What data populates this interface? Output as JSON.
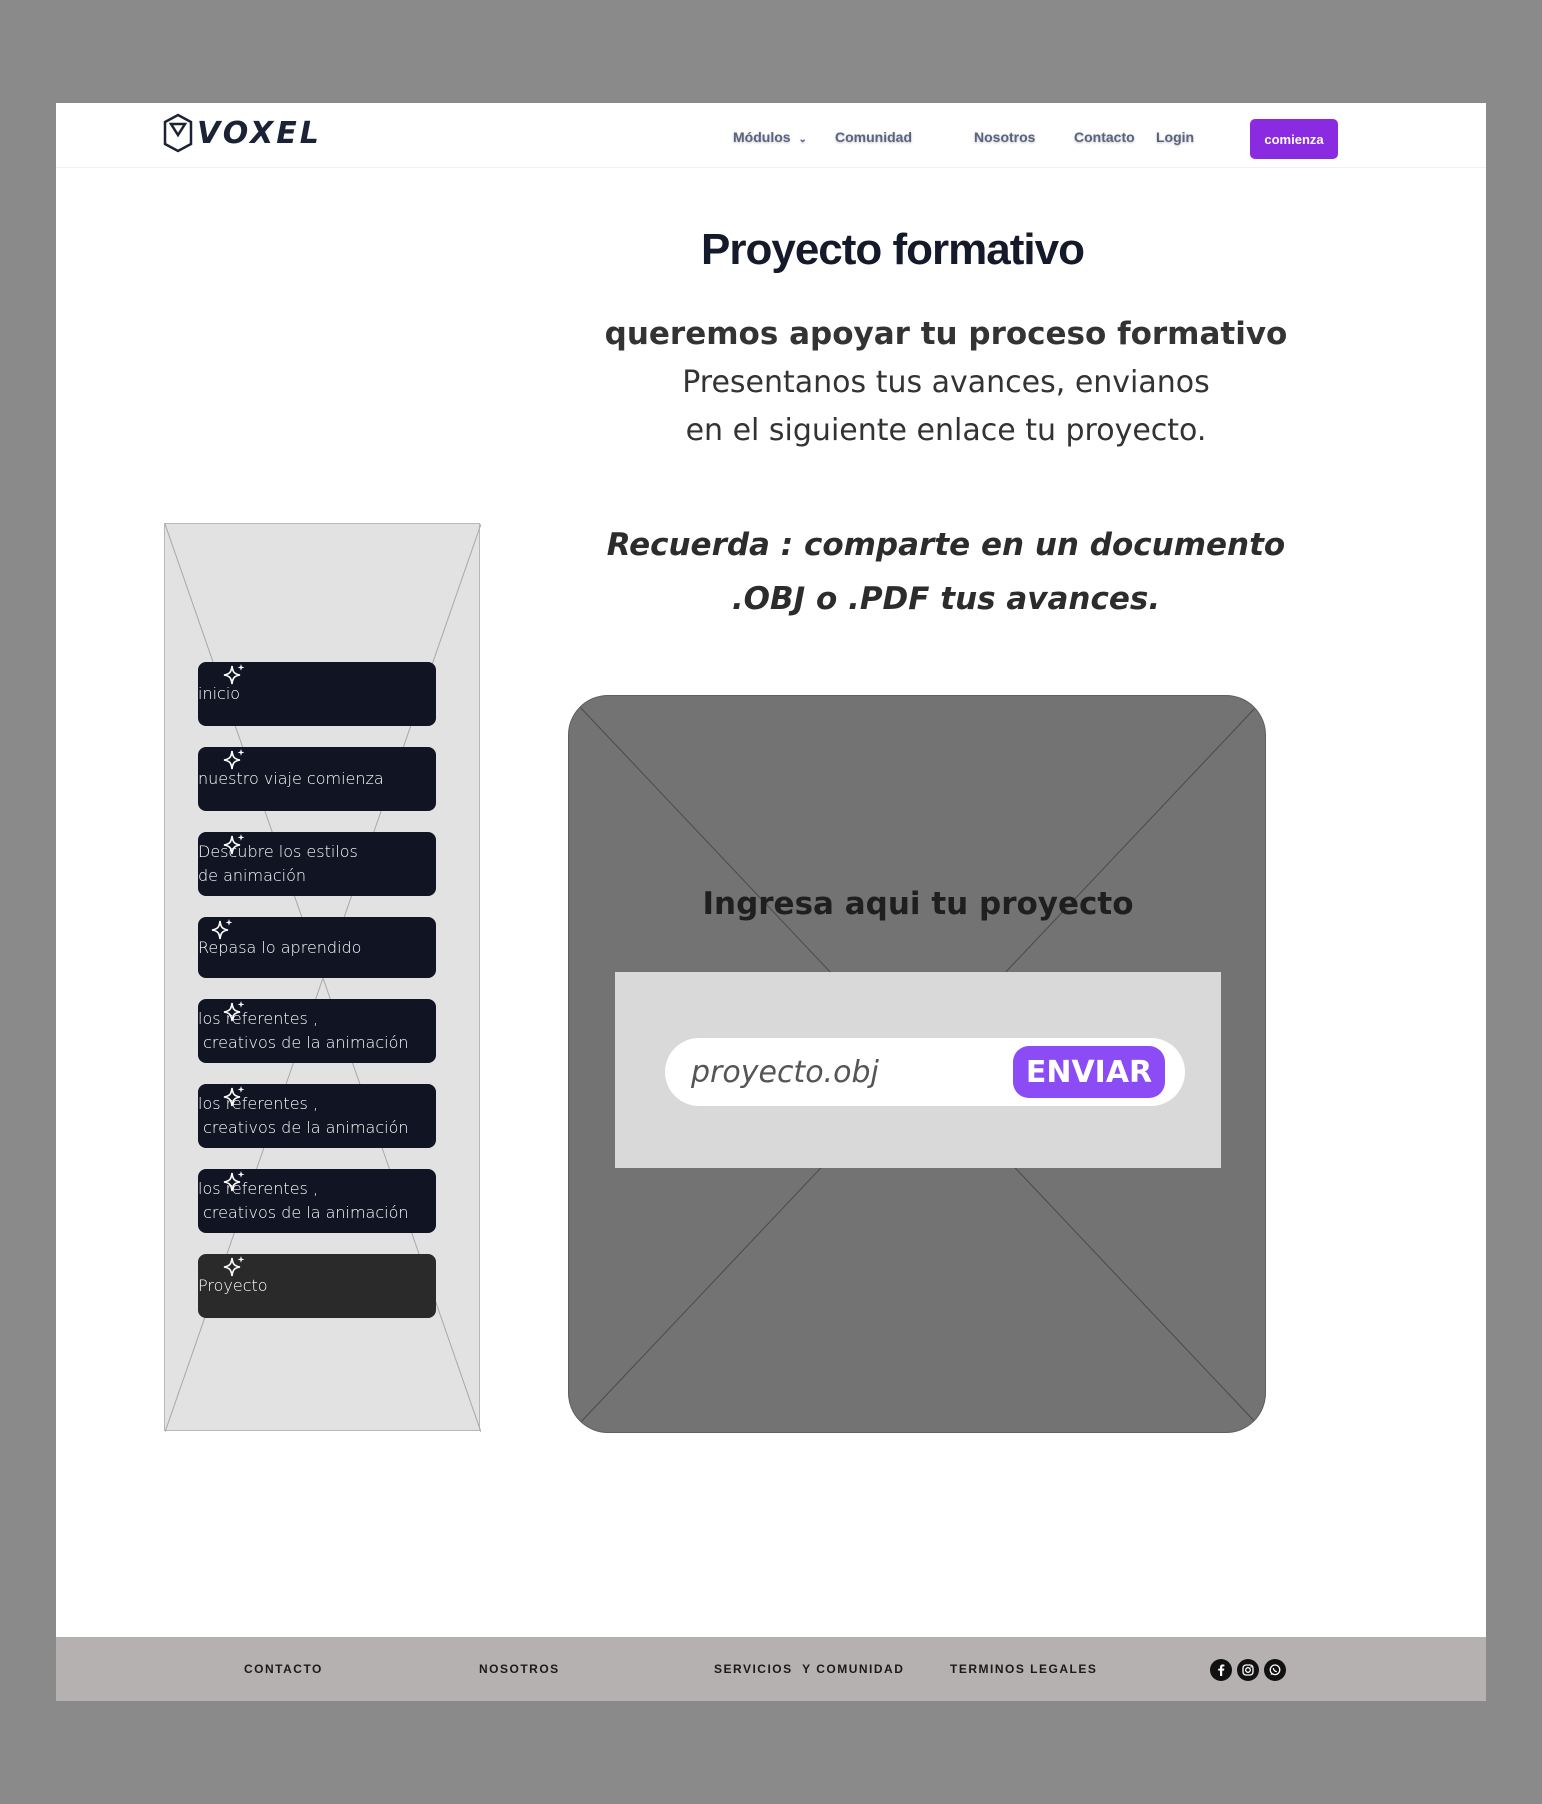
{
  "header": {
    "logo_text": "VOXEL",
    "nav": [
      {
        "label": "Módulos"
      },
      {
        "label": "Comunidad"
      },
      {
        "label": "Nosotros"
      },
      {
        "label": "Contacto"
      },
      {
        "label": "Login"
      }
    ],
    "cta_label": "comienza"
  },
  "hero": {
    "title": "Proyecto formativo",
    "subtitle_bold": "queremos apoyar tu proceso formativo",
    "subtitle_line1": "Presentanos tus avances, envianos",
    "subtitle_line2": "en el siguiente enlace tu proyecto.",
    "reminder_line1": "Recuerda : comparte en un documento",
    "reminder_line2": ".OBJ o .PDF tus avances."
  },
  "sidebar": {
    "items": [
      {
        "label": "inicio"
      },
      {
        "label": "nuestro viaje comienza"
      },
      {
        "label": "Descubre los estilos\nde animación"
      },
      {
        "label": "Repasa lo aprendido"
      },
      {
        "label": "los referentes ,\n creativos de la animación"
      },
      {
        "label": "los referentes ,\n creativos de la animación"
      },
      {
        "label": "los referentes ,\n creativos de la animación"
      },
      {
        "label": "Proyecto"
      }
    ]
  },
  "upload": {
    "title": "Ingresa aqui tu proyecto",
    "input_placeholder": "proyecto.obj",
    "send_label": "ENVIAR"
  },
  "footer": {
    "links": [
      {
        "label": "CONTACTO"
      },
      {
        "label": "NOSOTROS"
      },
      {
        "label": "SERVICIOS  Y COMUNIDAD"
      },
      {
        "label": "TERMINOS LEGALES"
      }
    ],
    "social_icons": [
      "facebook-icon",
      "instagram-icon",
      "whatsapp-icon"
    ]
  },
  "colors": {
    "accent": "#8a2be2",
    "send_button": "#8c4cf5",
    "menu_button": "#111523",
    "footer_bg": "#b6b1b1"
  }
}
